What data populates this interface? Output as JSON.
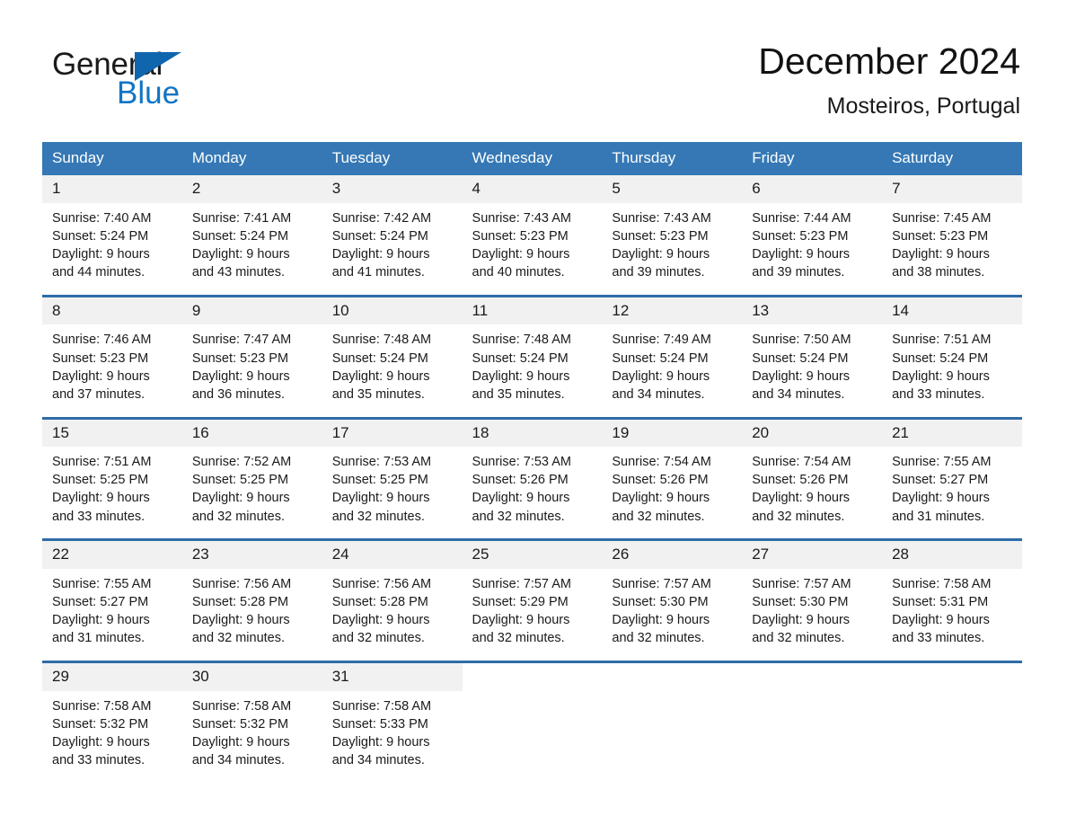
{
  "logo": {
    "word_primary": "General",
    "word_secondary": "Blue",
    "triangle_icon": "triangle-icon",
    "brand_blue": "#1175c4",
    "brand_dark_blue": "#1066ad"
  },
  "header": {
    "title": "December 2024",
    "subtitle": "Mosteiros, Portugal"
  },
  "calendar": {
    "header_bg": "#3578b5",
    "row_divider_color": "#2f6ca8",
    "daynum_bg": "#f1f1f1",
    "weekdays": [
      "Sunday",
      "Monday",
      "Tuesday",
      "Wednesday",
      "Thursday",
      "Friday",
      "Saturday"
    ],
    "weeks": [
      [
        {
          "day": "1",
          "sunrise": "Sunrise: 7:40 AM",
          "sunset": "Sunset: 5:24 PM",
          "daylight_line1": "Daylight: 9 hours",
          "daylight_line2": "and 44 minutes."
        },
        {
          "day": "2",
          "sunrise": "Sunrise: 7:41 AM",
          "sunset": "Sunset: 5:24 PM",
          "daylight_line1": "Daylight: 9 hours",
          "daylight_line2": "and 43 minutes."
        },
        {
          "day": "3",
          "sunrise": "Sunrise: 7:42 AM",
          "sunset": "Sunset: 5:24 PM",
          "daylight_line1": "Daylight: 9 hours",
          "daylight_line2": "and 41 minutes."
        },
        {
          "day": "4",
          "sunrise": "Sunrise: 7:43 AM",
          "sunset": "Sunset: 5:23 PM",
          "daylight_line1": "Daylight: 9 hours",
          "daylight_line2": "and 40 minutes."
        },
        {
          "day": "5",
          "sunrise": "Sunrise: 7:43 AM",
          "sunset": "Sunset: 5:23 PM",
          "daylight_line1": "Daylight: 9 hours",
          "daylight_line2": "and 39 minutes."
        },
        {
          "day": "6",
          "sunrise": "Sunrise: 7:44 AM",
          "sunset": "Sunset: 5:23 PM",
          "daylight_line1": "Daylight: 9 hours",
          "daylight_line2": "and 39 minutes."
        },
        {
          "day": "7",
          "sunrise": "Sunrise: 7:45 AM",
          "sunset": "Sunset: 5:23 PM",
          "daylight_line1": "Daylight: 9 hours",
          "daylight_line2": "and 38 minutes."
        }
      ],
      [
        {
          "day": "8",
          "sunrise": "Sunrise: 7:46 AM",
          "sunset": "Sunset: 5:23 PM",
          "daylight_line1": "Daylight: 9 hours",
          "daylight_line2": "and 37 minutes."
        },
        {
          "day": "9",
          "sunrise": "Sunrise: 7:47 AM",
          "sunset": "Sunset: 5:23 PM",
          "daylight_line1": "Daylight: 9 hours",
          "daylight_line2": "and 36 minutes."
        },
        {
          "day": "10",
          "sunrise": "Sunrise: 7:48 AM",
          "sunset": "Sunset: 5:24 PM",
          "daylight_line1": "Daylight: 9 hours",
          "daylight_line2": "and 35 minutes."
        },
        {
          "day": "11",
          "sunrise": "Sunrise: 7:48 AM",
          "sunset": "Sunset: 5:24 PM",
          "daylight_line1": "Daylight: 9 hours",
          "daylight_line2": "and 35 minutes."
        },
        {
          "day": "12",
          "sunrise": "Sunrise: 7:49 AM",
          "sunset": "Sunset: 5:24 PM",
          "daylight_line1": "Daylight: 9 hours",
          "daylight_line2": "and 34 minutes."
        },
        {
          "day": "13",
          "sunrise": "Sunrise: 7:50 AM",
          "sunset": "Sunset: 5:24 PM",
          "daylight_line1": "Daylight: 9 hours",
          "daylight_line2": "and 34 minutes."
        },
        {
          "day": "14",
          "sunrise": "Sunrise: 7:51 AM",
          "sunset": "Sunset: 5:24 PM",
          "daylight_line1": "Daylight: 9 hours",
          "daylight_line2": "and 33 minutes."
        }
      ],
      [
        {
          "day": "15",
          "sunrise": "Sunrise: 7:51 AM",
          "sunset": "Sunset: 5:25 PM",
          "daylight_line1": "Daylight: 9 hours",
          "daylight_line2": "and 33 minutes."
        },
        {
          "day": "16",
          "sunrise": "Sunrise: 7:52 AM",
          "sunset": "Sunset: 5:25 PM",
          "daylight_line1": "Daylight: 9 hours",
          "daylight_line2": "and 32 minutes."
        },
        {
          "day": "17",
          "sunrise": "Sunrise: 7:53 AM",
          "sunset": "Sunset: 5:25 PM",
          "daylight_line1": "Daylight: 9 hours",
          "daylight_line2": "and 32 minutes."
        },
        {
          "day": "18",
          "sunrise": "Sunrise: 7:53 AM",
          "sunset": "Sunset: 5:26 PM",
          "daylight_line1": "Daylight: 9 hours",
          "daylight_line2": "and 32 minutes."
        },
        {
          "day": "19",
          "sunrise": "Sunrise: 7:54 AM",
          "sunset": "Sunset: 5:26 PM",
          "daylight_line1": "Daylight: 9 hours",
          "daylight_line2": "and 32 minutes."
        },
        {
          "day": "20",
          "sunrise": "Sunrise: 7:54 AM",
          "sunset": "Sunset: 5:26 PM",
          "daylight_line1": "Daylight: 9 hours",
          "daylight_line2": "and 32 minutes."
        },
        {
          "day": "21",
          "sunrise": "Sunrise: 7:55 AM",
          "sunset": "Sunset: 5:27 PM",
          "daylight_line1": "Daylight: 9 hours",
          "daylight_line2": "and 31 minutes."
        }
      ],
      [
        {
          "day": "22",
          "sunrise": "Sunrise: 7:55 AM",
          "sunset": "Sunset: 5:27 PM",
          "daylight_line1": "Daylight: 9 hours",
          "daylight_line2": "and 31 minutes."
        },
        {
          "day": "23",
          "sunrise": "Sunrise: 7:56 AM",
          "sunset": "Sunset: 5:28 PM",
          "daylight_line1": "Daylight: 9 hours",
          "daylight_line2": "and 32 minutes."
        },
        {
          "day": "24",
          "sunrise": "Sunrise: 7:56 AM",
          "sunset": "Sunset: 5:28 PM",
          "daylight_line1": "Daylight: 9 hours",
          "daylight_line2": "and 32 minutes."
        },
        {
          "day": "25",
          "sunrise": "Sunrise: 7:57 AM",
          "sunset": "Sunset: 5:29 PM",
          "daylight_line1": "Daylight: 9 hours",
          "daylight_line2": "and 32 minutes."
        },
        {
          "day": "26",
          "sunrise": "Sunrise: 7:57 AM",
          "sunset": "Sunset: 5:30 PM",
          "daylight_line1": "Daylight: 9 hours",
          "daylight_line2": "and 32 minutes."
        },
        {
          "day": "27",
          "sunrise": "Sunrise: 7:57 AM",
          "sunset": "Sunset: 5:30 PM",
          "daylight_line1": "Daylight: 9 hours",
          "daylight_line2": "and 32 minutes."
        },
        {
          "day": "28",
          "sunrise": "Sunrise: 7:58 AM",
          "sunset": "Sunset: 5:31 PM",
          "daylight_line1": "Daylight: 9 hours",
          "daylight_line2": "and 33 minutes."
        }
      ],
      [
        {
          "day": "29",
          "sunrise": "Sunrise: 7:58 AM",
          "sunset": "Sunset: 5:32 PM",
          "daylight_line1": "Daylight: 9 hours",
          "daylight_line2": "and 33 minutes."
        },
        {
          "day": "30",
          "sunrise": "Sunrise: 7:58 AM",
          "sunset": "Sunset: 5:32 PM",
          "daylight_line1": "Daylight: 9 hours",
          "daylight_line2": "and 34 minutes."
        },
        {
          "day": "31",
          "sunrise": "Sunrise: 7:58 AM",
          "sunset": "Sunset: 5:33 PM",
          "daylight_line1": "Daylight: 9 hours",
          "daylight_line2": "and 34 minutes."
        },
        {
          "day": "",
          "sunrise": "",
          "sunset": "",
          "daylight_line1": "",
          "daylight_line2": ""
        },
        {
          "day": "",
          "sunrise": "",
          "sunset": "",
          "daylight_line1": "",
          "daylight_line2": ""
        },
        {
          "day": "",
          "sunrise": "",
          "sunset": "",
          "daylight_line1": "",
          "daylight_line2": ""
        },
        {
          "day": "",
          "sunrise": "",
          "sunset": "",
          "daylight_line1": "",
          "daylight_line2": ""
        }
      ]
    ]
  }
}
